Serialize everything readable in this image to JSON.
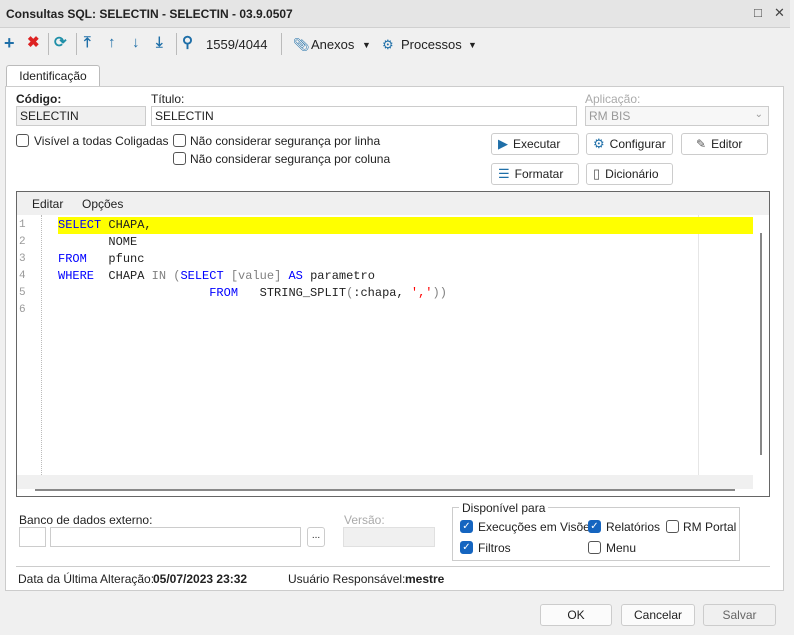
{
  "window": {
    "title": "Consultas SQL: SELECTIN - SELECTIN - 03.9.0507",
    "restore": "□",
    "close": "✕"
  },
  "toolbar": {
    "record_counter": "1559/4044",
    "attachments": "Anexos",
    "processes": "Processos"
  },
  "tabs": [
    {
      "label": "Identificação",
      "active": true
    }
  ],
  "form": {
    "code_label": "Código:",
    "code_value": "SELECTIN",
    "title_label": "Título:",
    "title_value": "SELECTIN",
    "app_label": "Aplicação:",
    "app_value": "RM BIS",
    "visible_all": {
      "label": "Visível a todas Coligadas",
      "checked": false
    },
    "no_row_security": {
      "label": "Não considerar segurança por linha",
      "checked": false
    },
    "no_col_security": {
      "label": "Não considerar segurança por coluna",
      "checked": false
    },
    "buttons": {
      "execute": "Executar",
      "configure": "Configurar",
      "editor": "Editor",
      "format": "Formatar",
      "dictionary": "Dicionário"
    }
  },
  "editor": {
    "menu": [
      "Editar",
      "Opções"
    ],
    "line_numbers": [
      "1",
      "2",
      "3",
      "4",
      "5",
      "6"
    ],
    "current_line": 1
  },
  "bottom": {
    "external_db_label": "Banco de dados externo:",
    "browse": "...",
    "version_label": "Versão:",
    "available_for": {
      "legend": "Disponível para",
      "views": {
        "label": "Execuções em Visões",
        "checked": true
      },
      "reports": {
        "label": "Relatórios",
        "checked": true
      },
      "portal": {
        "label": "RM Portal",
        "checked": false
      },
      "filters": {
        "label": "Filtros",
        "checked": true
      },
      "menu": {
        "label": "Menu",
        "checked": false
      }
    },
    "last_change_label": "Data da Última Alteração:",
    "last_change_value": "05/07/2023 23:32",
    "user_label": "Usuário Responsável:",
    "user_value": "mestre"
  },
  "footer": {
    "ok": "OK",
    "cancel": "Cancelar",
    "save": "Salvar"
  },
  "colors": {
    "accent": "#1565c0",
    "highlight": "#ffff00",
    "keyword": "#0000ff",
    "string": "#ff0000"
  }
}
